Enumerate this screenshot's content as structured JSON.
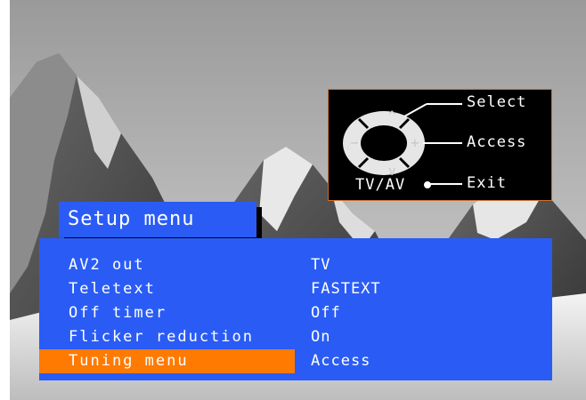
{
  "keypad": {
    "select_label": "Select",
    "access_label": "Access",
    "exit_label": "Exit",
    "tvav_label": "TV/AV",
    "up_glyph": "^",
    "down_glyph": "v",
    "minus_glyph": "−",
    "plus_glyph": "+"
  },
  "menu": {
    "title": "Setup menu",
    "items": [
      {
        "label": "AV2 out",
        "value": "TV",
        "selected": false
      },
      {
        "label": "Teletext",
        "value": "FASTEXT",
        "selected": false
      },
      {
        "label": "Off timer",
        "value": "Off",
        "selected": false
      },
      {
        "label": "Flicker reduction",
        "value": "On",
        "selected": false
      },
      {
        "label": "Tuning menu",
        "value": "Access",
        "selected": true
      }
    ]
  },
  "colors": {
    "menu_blue": "#2a5cf5",
    "highlight_orange": "#ff7a00",
    "panel_border": "#c87030"
  }
}
